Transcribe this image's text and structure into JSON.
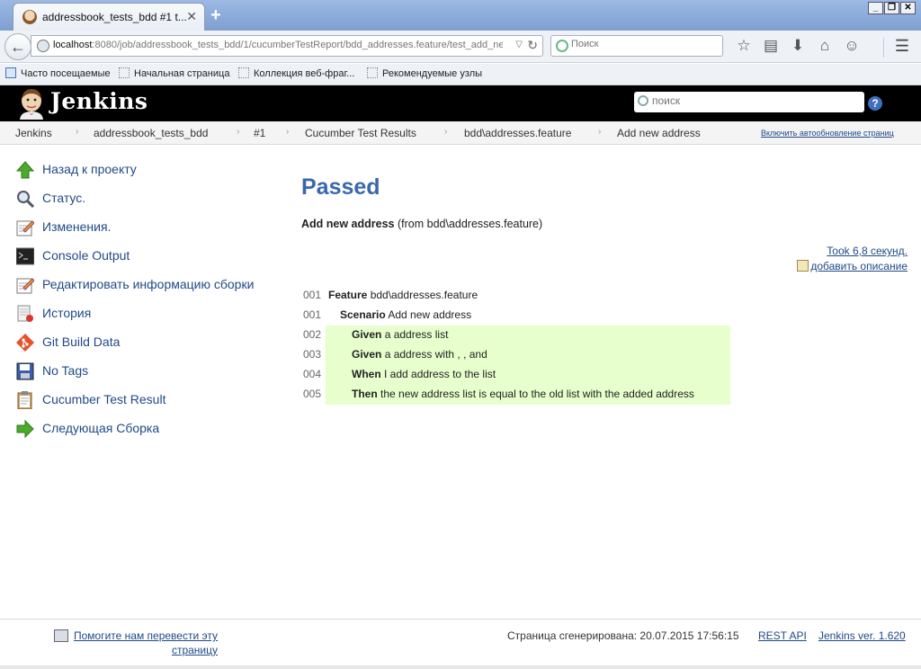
{
  "browser": {
    "tab_title": "addressbook_tests_bdd #1 t...",
    "url_host": "localhost",
    "url_rest": ":8080/job/addressbook_tests_bdd/1/cucumberTestReport/bdd_addresses.feature/test_add_ne",
    "search_placeholder": "Поиск",
    "bookmarks": [
      "Часто посещаемые",
      "Начальная страница",
      "Коллекция веб-фраг...",
      "Рекомендуемые узлы"
    ]
  },
  "header": {
    "logo_text": "Jenkins",
    "search_placeholder": "поиск",
    "help_label": "?"
  },
  "breadcrumbs": {
    "items": [
      "Jenkins",
      "addressbook_tests_bdd",
      "#1",
      "Cucumber Test Results",
      "bdd\\addresses.feature",
      "Add new address"
    ],
    "separator": "›",
    "autorefresh": "Включить автообновление страниц"
  },
  "sidebar": {
    "items": [
      {
        "label": "Назад к проекту",
        "icon": "up-arrow-icon"
      },
      {
        "label": "Статус.",
        "icon": "magnifier-icon"
      },
      {
        "label": "Изменения.",
        "icon": "notepad-icon"
      },
      {
        "label": "Console Output",
        "icon": "terminal-icon"
      },
      {
        "label": "Редактировать информацию сборки",
        "icon": "notepad-icon"
      },
      {
        "label": "История",
        "icon": "history-icon"
      },
      {
        "label": "Git Build Data",
        "icon": "git-icon"
      },
      {
        "label": "No Tags",
        "icon": "floppy-icon"
      },
      {
        "label": "Cucumber Test Result",
        "icon": "clipboard-icon"
      },
      {
        "label": "Следующая Сборка",
        "icon": "next-arrow-icon"
      }
    ]
  },
  "main": {
    "status": "Passed",
    "scenario_name": "Add new address",
    "scenario_from": "(from bdd\\addresses.feature)",
    "took": "Took 6,8 секунд.",
    "add_description": "добавить описание",
    "steps": [
      {
        "line": "001",
        "keyword": "Feature",
        "text": "bdd\\addresses.feature",
        "indent": 0,
        "passed": false
      },
      {
        "line": "001",
        "keyword": "Scenario",
        "text": "Add new address",
        "indent": 1,
        "passed": false
      },
      {
        "line": "002",
        "keyword": "Given",
        "text": "a address list",
        "indent": 2,
        "passed": true
      },
      {
        "line": "003",
        "keyword": "Given",
        "text": "a address with , , and",
        "indent": 2,
        "passed": true
      },
      {
        "line": "004",
        "keyword": "When",
        "text": "I add address to the list",
        "indent": 2,
        "passed": true
      },
      {
        "line": "005",
        "keyword": "Then",
        "text": "the new address list is equal to the old list with the added address",
        "indent": 2,
        "passed": true
      }
    ]
  },
  "footer": {
    "translate_line1": "Помогите нам перевести эту",
    "translate_line2": "страницу",
    "generated": "Страница сгенерирована: 20.07.2015 17:56:15",
    "rest_api": "REST API",
    "version": "Jenkins ver. 1.620"
  },
  "colors": {
    "accent": "#3968ad",
    "link": "#204a87",
    "passed_bg": "#e6ffcc",
    "header_bg": "#000000"
  }
}
